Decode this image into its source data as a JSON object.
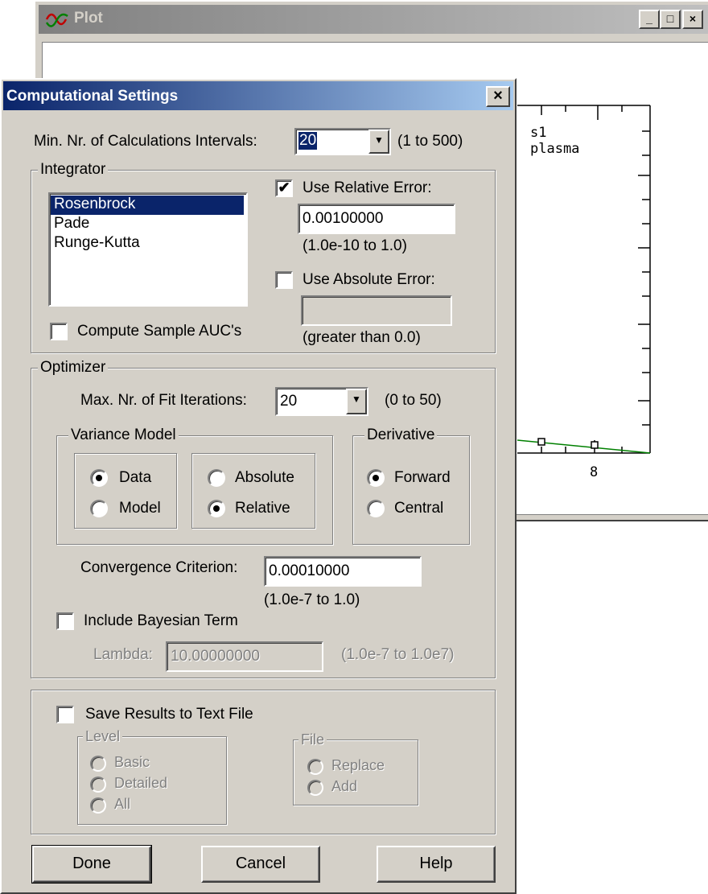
{
  "plot_window": {
    "title": "Plot",
    "min_btn": "_",
    "max_btn": "□",
    "close_btn": "×",
    "legend_line1": "s1",
    "legend_line2": "plasma",
    "axis_tick_label": "8"
  },
  "dialog": {
    "title": "Computational Settings",
    "close_btn": "×",
    "min_intervals": {
      "label": "Min. Nr. of Calculations Intervals:",
      "value": "20",
      "range": "(1 to 500)"
    },
    "integrator": {
      "group_label": "Integrator",
      "methods": [
        "Rosenbrock",
        "Pade",
        "Runge-Kutta"
      ],
      "selected_index": 0,
      "use_relative_error": {
        "label": "Use Relative Error:",
        "checked": true,
        "value": "0.00100000",
        "range": "(1.0e-10 to 1.0)"
      },
      "use_absolute_error": {
        "label": "Use Absolute Error:",
        "checked": false,
        "value": "",
        "range": "(greater than 0.0)"
      },
      "compute_auc": {
        "label": "Compute Sample AUC's",
        "checked": false
      }
    },
    "optimizer": {
      "group_label": "Optimizer",
      "max_iterations": {
        "label": "Max. Nr. of Fit Iterations:",
        "value": "20",
        "range": "(0 to 50)"
      },
      "variance_model": {
        "group_label": "Variance Model",
        "source": {
          "data": "Data",
          "model": "Model",
          "selected": "Data"
        },
        "type": {
          "absolute": "Absolute",
          "relative": "Relative",
          "selected": "Relative"
        }
      },
      "derivative": {
        "group_label": "Derivative",
        "forward": "Forward",
        "central": "Central",
        "selected": "Forward"
      },
      "convergence": {
        "label": "Convergence Criterion:",
        "value": "0.00010000",
        "range": "(1.0e-7 to 1.0)"
      },
      "bayesian": {
        "label": "Include Bayesian Term",
        "checked": false
      },
      "lambda": {
        "label": "Lambda:",
        "value": "10.00000000",
        "range": "(1.0e-7 to 1.0e7)"
      }
    },
    "save_results": {
      "label": "Save Results to Text File",
      "checked": false,
      "level": {
        "group_label": "Level",
        "options": [
          "Basic",
          "Detailed",
          "All"
        ]
      },
      "file": {
        "group_label": "File",
        "options": [
          "Replace",
          "Add"
        ]
      }
    },
    "buttons": {
      "done": "Done",
      "cancel": "Cancel",
      "help": "Help"
    }
  },
  "colors": {
    "dialog_title": "#0a246a",
    "selection": "#0a246a",
    "plot_line": "#008000"
  }
}
